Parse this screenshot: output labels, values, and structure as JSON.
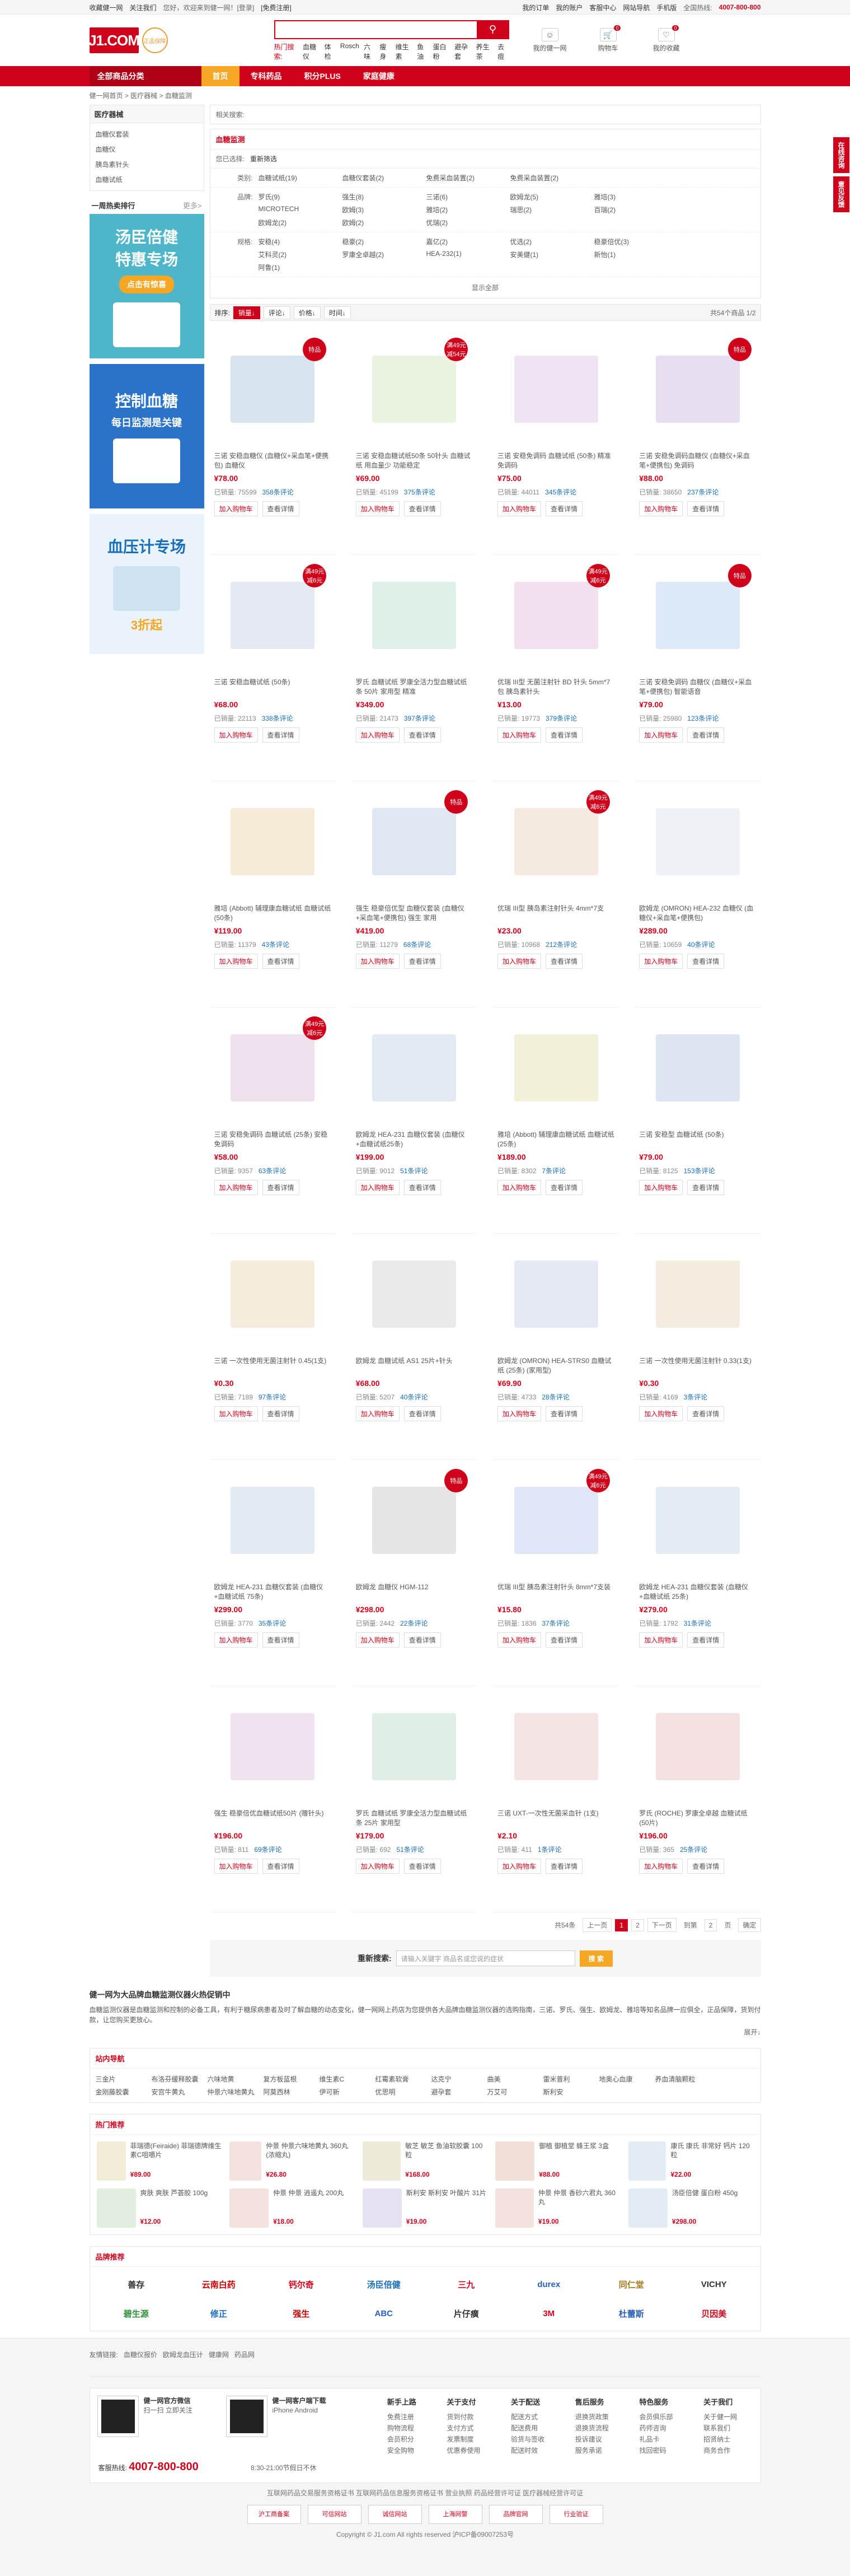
{
  "topbar": {
    "left": [
      "收藏健一网",
      "关注我们"
    ],
    "greeting": "您好，欢迎来到健一网！[登录]",
    "register": "[免费注册]",
    "right": [
      "我的订单",
      "我的账户",
      "客服中心",
      "网站导航",
      "手机版"
    ],
    "phone_label": "全国热线:",
    "phone": "4007-800-800"
  },
  "header": {
    "logo_text": "J1.COM",
    "logo_cn": "健一网",
    "badge_text": "正品保障",
    "search_placeholder": "",
    "search_button": "搜索",
    "hot_words": [
      "热门搜索:",
      "血糖仪",
      "体检",
      "Rosch",
      "六味",
      "瘦身",
      "维生素",
      "鱼油",
      "蛋白粉",
      "避孕套",
      "养生茶",
      "去痘"
    ],
    "account_label": "我的健一网",
    "cart_label": "购物车",
    "cart_count": "0",
    "favorite_label": "我的收藏",
    "favorite_count": "0"
  },
  "nav": {
    "all_categories": "全部商品分类",
    "items": [
      "首页",
      "专科药品",
      "积分PLUS",
      "家庭健康"
    ]
  },
  "breadcrumb": "健一网首页 > 医疗器械 > 血糖监测",
  "sidebar": {
    "category_title": "医疗器械",
    "categories": [
      "血糖仪套装",
      "血糖仪",
      "胰岛素针头",
      "血糖试纸"
    ],
    "ranking_title": "一周热卖排行",
    "ranking_more": "更多>",
    "promo1": {
      "title": "汤臣倍健",
      "sub": "特惠专场",
      "btn": "点击有惊喜"
    },
    "promo2": {
      "title": "控制血糖",
      "sub": "每日监测是关键"
    },
    "promo3": {
      "title": "血压计专场",
      "sub": "3折起"
    }
  },
  "main": {
    "related_label": "相关搜索:",
    "category_name": "血糖监测",
    "chosen_label": "您已选择:",
    "chosen_value": "重新筛选",
    "filters": [
      {
        "label": "类别:",
        "options": [
          "血糖试纸(19)",
          "血糖仪套装(2)",
          "免费采血装置(2)",
          "免费采血装置(2)"
        ]
      },
      {
        "label": "品牌:",
        "options": [
          "罗氏(9)",
          "强生(8)",
          "三诺(6)",
          "欧姆龙(5)",
          "雅培(3)",
          "MICROTECH",
          "欧姆(3)",
          "雅培(2)",
          "瑞思(2)",
          "百瑞(2)",
          "欧姆龙(2)",
          "欧姆(2)",
          "优瑞(2)"
        ]
      },
      {
        "label": "规格:",
        "options": [
          "安稳(4)",
          "稳豪(2)",
          "嘉亿(2)",
          "优选(2)",
          "稳豪倍优(3)",
          "艾科灵(2)",
          "罗康全卓越(2)",
          "HEA-232(1)",
          "安美健(1)",
          "新怡(1)",
          "阿鲁(1)"
        ]
      }
    ],
    "show_all": "显示全部",
    "sort": {
      "label": "排序:",
      "options": [
        "销量↓",
        "评论↓",
        "价格↓",
        "时间↓"
      ],
      "total": "共54个商品 1/2"
    },
    "products": [
      {
        "title": "三诺 安稳血糖仪 (血糖仪+采血笔+便携包) 血糖仪",
        "price": "¥78.00",
        "sold": "已销量: 75599",
        "reviews": "358条评论",
        "tag": "特品",
        "color": "#d7e4ef"
      },
      {
        "title": "三诺 安稳血糖试纸50条 50针头 血糖试纸 用血量少 功能稳定",
        "price": "¥69.00",
        "sold": "已销量: 45199",
        "reviews": "375条评论",
        "tag": "满49元减54元",
        "color": "#eaf2e0"
      },
      {
        "title": "三诺 安稳免调码 血糖试纸 (50条) 精准 免调码",
        "price": "¥75.00",
        "sold": "已销量: 44011",
        "reviews": "345条评论",
        "tag": "",
        "color": "#eee4f2"
      },
      {
        "title": "三诺 安稳免调码血糖仪 (血糖仪+采血笔+便携包) 免调码",
        "price": "¥88.00",
        "sold": "已销量: 38650",
        "reviews": "237条评论",
        "tag": "特品",
        "color": "#e7def2"
      },
      {
        "title": "三诺 安稳血糖试纸 (50条)",
        "price": "¥68.00",
        "sold": "已销量: 22113",
        "reviews": "338条评论",
        "tag": "满49元减6元",
        "color": "#e4e9f2"
      },
      {
        "title": "罗氏 血糖试纸 罗康全活力型血糖试纸条 50片 家用型 精准",
        "price": "¥349.00",
        "sold": "已销量: 21473",
        "reviews": "397条评论",
        "tag": "",
        "color": "#dff0e8"
      },
      {
        "title": "优瑞 III型 无菌注射针 BD 针头 5mm*7包 胰岛素针头",
        "price": "¥13.00",
        "sold": "已销量: 19773",
        "reviews": "379条评论",
        "tag": "满49元减6元",
        "color": "#f2e0ee"
      },
      {
        "title": "三诺 安稳免调码 血糖仪 (血糖仪+采血笔+便携包) 智能语音",
        "price": "¥79.00",
        "sold": "已销量: 25980",
        "reviews": "123条评论",
        "tag": "特品",
        "color": "#dceaf7"
      },
      {
        "title": "雅培 (Abbott) 辅理康血糖试纸 血糖试纸 (50条)",
        "price": "¥119.00",
        "sold": "已销量: 11379",
        "reviews": "43条评论",
        "tag": "",
        "color": "#f4ead6"
      },
      {
        "title": "强生 稳豪倍优型 血糖仪套装 (血糖仪+采血笔+便携包) 强生 家用",
        "price": "¥419.00",
        "sold": "已销量: 11279",
        "reviews": "68条评论",
        "tag": "特品",
        "color": "#dfe7f2"
      },
      {
        "title": "优瑞 III型 胰岛素注射针头 4mm*7支",
        "price": "¥23.00",
        "sold": "已销量: 10968",
        "reviews": "212条评论",
        "tag": "满49元减6元",
        "color": "#f5eadf"
      },
      {
        "title": "欧姆龙 (OMRON) HEA-232 血糖仪 (血糖仪+采血笔+便携包)",
        "price": "¥289.00",
        "sold": "已销量: 10659",
        "reviews": "40条评论",
        "tag": "",
        "color": "#eef1f5"
      },
      {
        "title": "三诺 安稳免调码 血糖试纸 (25条) 安稳 免调码",
        "price": "¥58.00",
        "sold": "已销量: 9357",
        "reviews": "63条评论",
        "tag": "满49元减6元",
        "color": "#eee0ec"
      },
      {
        "title": "欧姆龙 HEA-231 血糖仪套装 (血糖仪+血糖试纸25条)",
        "price": "¥199.00",
        "sold": "已销量: 9012",
        "reviews": "51条评论",
        "tag": "",
        "color": "#e3eaf2"
      },
      {
        "title": "雅培 (Abbott) 辅理康血糖试纸 血糖试纸 (25条)",
        "price": "¥189.00",
        "sold": "已销量: 8302",
        "reviews": "7条评论",
        "tag": "",
        "color": "#f3f0d9"
      },
      {
        "title": "三诺 安稳型 血糖试纸 (50条)",
        "price": "¥79.00",
        "sold": "已销量: 8125",
        "reviews": "153条评论",
        "tag": "",
        "color": "#dde5f3"
      },
      {
        "title": "三诺 一次性使用无菌注射针 0.45(1支)",
        "price": "¥0.30",
        "sold": "已销量: 7189",
        "reviews": "97条评论",
        "tag": "",
        "color": "#f5ecdd"
      },
      {
        "title": "欧姆龙 血糖试纸 AS1 25片+针头",
        "price": "¥68.00",
        "sold": "已销量: 5207",
        "reviews": "40条评论",
        "tag": "",
        "color": "#eaeaea"
      },
      {
        "title": "欧姆龙 (OMRON) HEA-STRS0 血糖试纸 (25条) (家用型)",
        "price": "¥69.90",
        "sold": "已销量: 4733",
        "reviews": "28条评论",
        "tag": "",
        "color": "#e4e9f3"
      },
      {
        "title": "三诺 一次性使用无菌注射针 0.33(1支)",
        "price": "¥0.30",
        "sold": "已销量: 4169",
        "reviews": "3条评论",
        "tag": "",
        "color": "#f3ecdf"
      },
      {
        "title": "欧姆龙 HEA-231 血糖仪套装 (血糖仪+血糖试纸 75条)",
        "price": "¥299.00",
        "sold": "已销量: 3770",
        "reviews": "35条评论",
        "tag": "",
        "color": "#e2ebf3"
      },
      {
        "title": "欧姆龙 血糖仪 HGM-112",
        "price": "¥298.00",
        "sold": "已销量: 2442",
        "reviews": "22条评论",
        "tag": "特品",
        "color": "#e5e5e5"
      },
      {
        "title": "优瑞 III型 胰岛素注射针头 8mm*7支装",
        "price": "¥15.80",
        "sold": "已销量: 1836",
        "reviews": "37条评论",
        "tag": "满49元减6元",
        "color": "#dfe6f5"
      },
      {
        "title": "欧姆龙 HEA-231 血糖仪套装 (血糖仪+血糖试纸 25条)",
        "price": "¥279.00",
        "sold": "已销量: 1792",
        "reviews": "31条评论",
        "tag": "",
        "color": "#e3ebf3"
      },
      {
        "title": "强生 稳豪倍优血糖试纸50片 (赠针头)",
        "price": "¥196.00",
        "sold": "已销量: 811",
        "reviews": "69条评论",
        "tag": "",
        "color": "#efe3f0"
      },
      {
        "title": "罗氏 血糖试纸 罗康全活力型血糖试纸条 25片 家用型",
        "price": "¥179.00",
        "sold": "已销量: 692",
        "reviews": "51条评论",
        "tag": "",
        "color": "#e0efe6"
      },
      {
        "title": "三诺 UXT-一次性无菌采血针 (1支)",
        "price": "¥2.10",
        "sold": "已销量: 411",
        "reviews": "1条评论",
        "tag": "",
        "color": "#f5e4e4"
      },
      {
        "title": "罗氏 (ROCHE) 罗康全卓越 血糖试纸 (50片)",
        "price": "¥196.00",
        "sold": "已销量: 365",
        "reviews": "25条评论",
        "tag": "",
        "color": "#f3e0e0"
      }
    ],
    "btn_cart": "加入购物车",
    "btn_detail": "查看详情",
    "pager": {
      "total": "共54条",
      "prev": "上一页",
      "pages": [
        "1",
        "2"
      ],
      "next": "下一页",
      "goto": "到第",
      "unit": "页",
      "ok": "确定",
      "page_input": "2"
    },
    "research_label": "重新搜索:",
    "research_placeholder": "请输入关键字 商品名或您说的症状",
    "research_btn": "搜 索"
  },
  "seo": {
    "title": "健一网为大品牌血糖监测仪器火热促销中",
    "text": "血糖监测仪器是血糖监测和控制的必备工具，有利于糖尿病患者及时了解血糖的动态变化，健一网网上药店为您提供各大品牌血糖监测仪器的选购指南，三诺、罗氏、强生、欧姆龙、雅培等知名品牌一应俱全，正品保障，货到付款，让您购买更放心。",
    "unfold": "展开↓"
  },
  "links_block": {
    "title": "站内导航",
    "items": [
      "三金片",
      "布洛芬缓释胶囊",
      "六味地黄",
      "复方板蓝根",
      "维生素C",
      "红霉素软膏",
      "达克宁",
      "曲美",
      "雷米普利",
      "地奥心血康",
      "养血清脑颗粒",
      "金刚藤胶囊",
      "安宫牛黄丸",
      "仲景六味地黄丸",
      "阿莫西林",
      "伊可新",
      "优思明",
      "避孕套",
      "万艾可",
      "斯利安"
    ]
  },
  "recs_block": {
    "title": "热门推荐",
    "items": [
      {
        "t": "菲瑞德(Feiraide) 菲瑞德牌维生素C咀嚼片",
        "p": "¥89.00",
        "c": "#f1ecd8"
      },
      {
        "t": "仲景 仲景六味地黄丸 360丸 (浓缩丸)",
        "p": "¥26.80",
        "c": "#f3e2de"
      },
      {
        "t": "敏芝 敏芝 鱼油软胶囊 100粒",
        "p": "¥168.00",
        "c": "#eeead8"
      },
      {
        "t": "御植 御植堂 蜂王浆 3盒",
        "p": "¥88.00",
        "c": "#f0e0d8"
      },
      {
        "t": "康氏 康氏 非常好 钙片 120粒",
        "p": "¥22.00",
        "c": "#e2ecf3"
      },
      {
        "t": "爽肤 爽肤 芦荟胶 100g",
        "p": "¥12.00",
        "c": "#e0efe0"
      },
      {
        "t": "仲景 仲景 逍遥丸 200丸",
        "p": "¥18.00",
        "c": "#f3e2de"
      },
      {
        "t": "斯利安 斯利安 叶酸片 31片",
        "p": "¥19.00",
        "c": "#e8e0f3"
      },
      {
        "t": "仲景 仲景 香砂六君丸 360丸",
        "p": "¥19.00",
        "c": "#f3e2de"
      },
      {
        "t": "汤臣倍健 蛋白粉 450g",
        "p": "¥298.00",
        "c": "#e2ecf3"
      }
    ]
  },
  "brands_block": {
    "title": "品牌推荐",
    "items": [
      {
        "n": "善存",
        "c": "#333"
      },
      {
        "n": "云南白药",
        "c": "#c00"
      },
      {
        "n": "钙尔奇",
        "c": "#d0021b"
      },
      {
        "n": "汤臣倍健",
        "c": "#1a6fb8"
      },
      {
        "n": "三九",
        "c": "#d0021b"
      },
      {
        "n": "durex",
        "c": "#2a5fb8"
      },
      {
        "n": "同仁堂",
        "c": "#a57a20"
      },
      {
        "n": "VICHY",
        "c": "#333"
      },
      {
        "n": "碧生源",
        "c": "#2f8f3a"
      },
      {
        "n": "修正",
        "c": "#1a6fb8"
      },
      {
        "n": "强生",
        "c": "#c00"
      },
      {
        "n": "ABC",
        "c": "#2a5fb8"
      },
      {
        "n": "片仔癀",
        "c": "#333"
      },
      {
        "n": "3M",
        "c": "#d0021b"
      },
      {
        "n": "杜蕾斯",
        "c": "#2a5fb8"
      },
      {
        "n": "贝因美",
        "c": "#d0021b"
      }
    ]
  },
  "footer": {
    "friend_links": [
      "友情链接:",
      "血糖仪报价",
      "欧姆龙血压计",
      "健康网",
      "药品网"
    ],
    "app": {
      "title": "健一网官方微信",
      "desc": "扫一扫 立即关注"
    },
    "app2": {
      "title": "健一网客户端下载",
      "desc": "iPhone  Android"
    },
    "hotline_label": "客服热线:",
    "hotline": "4007-800-800",
    "hours": "8:30-21:00节假日不休",
    "cols": [
      {
        "h": "新手上路",
        "items": [
          "免费注册",
          "购物流程",
          "会员积分",
          "安全购物"
        ]
      },
      {
        "h": "关于支付",
        "items": [
          "货到付款",
          "支付方式",
          "发票制度",
          "优惠券使用"
        ]
      },
      {
        "h": "关于配送",
        "items": [
          "配送方式",
          "配送费用",
          "验货与签收",
          "配送时效"
        ]
      },
      {
        "h": "售后服务",
        "items": [
          "退换货政策",
          "退换货流程",
          "投诉建议",
          "服务承诺"
        ]
      },
      {
        "h": "特色服务",
        "items": [
          "会员俱乐部",
          "药师咨询",
          "礼品卡",
          "找回密码"
        ]
      },
      {
        "h": "关于我们",
        "items": [
          "关于健一网",
          "联系我们",
          "招贤纳士",
          "商务合作"
        ]
      }
    ],
    "bottom1": "互联网药品交易服务资格证书 互联网药品信息服务资格证书 营业执照 药品经营许可证 医疗器械经营许可证",
    "bottom2": "Copyright © J1.com All rights reserved 沪ICP备09007253号",
    "badges": [
      "沪工商备案",
      "可信网站",
      "诚信网站",
      "上海网警",
      "品牌官网",
      "行业验证"
    ]
  },
  "float": [
    "在线咨询",
    "意见反馈"
  ]
}
